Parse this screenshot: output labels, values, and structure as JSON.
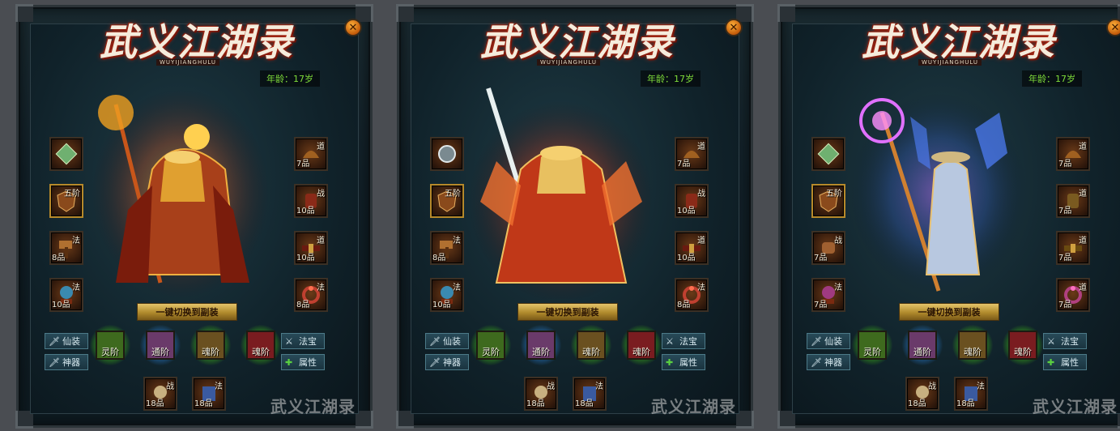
{
  "panels": [
    {
      "variant": "fire",
      "title": "武义江湖录",
      "subtitle": "WUYIJIANGHULU",
      "age": "年龄：17岁",
      "left_slots": [
        {
          "tag": "",
          "grade": "",
          "icon": "jade-crystal-icon"
        },
        {
          "tag": "五阶",
          "grade": "",
          "icon": "shield-icon"
        },
        {
          "tag": "法",
          "grade": "8品",
          "icon": "hammer-icon"
        },
        {
          "tag": "法",
          "grade": "10品",
          "icon": "orb-boots-icon"
        }
      ],
      "right_slots": [
        {
          "tag": "道",
          "grade": "7品",
          "icon": "helmet-icon"
        },
        {
          "tag": "战",
          "grade": "10品",
          "icon": "gauntlet-icon"
        },
        {
          "tag": "道",
          "grade": "10品",
          "icon": "belt-icon"
        },
        {
          "tag": "法",
          "grade": "8品",
          "icon": "ring-icon"
        }
      ]
    },
    {
      "variant": "warrior",
      "title": "武义江湖录",
      "subtitle": "WUYIJIANGHULU",
      "age": "年龄：17岁",
      "left_slots": [
        {
          "tag": "",
          "grade": "",
          "icon": "medallion-icon"
        },
        {
          "tag": "五阶",
          "grade": "",
          "icon": "shield-icon"
        },
        {
          "tag": "法",
          "grade": "8品",
          "icon": "hammer-icon"
        },
        {
          "tag": "法",
          "grade": "10品",
          "icon": "orb-boots-icon"
        }
      ],
      "right_slots": [
        {
          "tag": "道",
          "grade": "7品",
          "icon": "helmet-icon"
        },
        {
          "tag": "战",
          "grade": "10品",
          "icon": "gauntlet-icon"
        },
        {
          "tag": "道",
          "grade": "10品",
          "icon": "belt-icon"
        },
        {
          "tag": "法",
          "grade": "8品",
          "icon": "ring-icon"
        }
      ]
    },
    {
      "variant": "mage",
      "title": "武义江湖录",
      "subtitle": "WUYIJIANGHULU",
      "age": "年龄：17岁",
      "left_slots": [
        {
          "tag": "",
          "grade": "",
          "icon": "jade-crystal-icon"
        },
        {
          "tag": "五阶",
          "grade": "",
          "icon": "shield-icon"
        },
        {
          "tag": "战",
          "grade": "7品",
          "icon": "bracer-icon"
        },
        {
          "tag": "法",
          "grade": "7品",
          "icon": "orb-boots-icon"
        }
      ],
      "right_slots": [
        {
          "tag": "道",
          "grade": "7品",
          "icon": "helmet-icon"
        },
        {
          "tag": "道",
          "grade": "7品",
          "icon": "gauntlet-icon"
        },
        {
          "tag": "道",
          "grade": "7品",
          "icon": "belt-icon"
        },
        {
          "tag": "道",
          "grade": "7品",
          "icon": "ring-icon"
        }
      ]
    }
  ],
  "common": {
    "switch_label": "一键切换到副装",
    "xianzhuang": "仙装",
    "shenqi": "神器",
    "fabao": "法宝",
    "shuxing": "属性",
    "ranks": [
      "灵阶",
      "通阶",
      "魂阶",
      "魂阶"
    ],
    "bottom_slots": [
      {
        "tag": "战",
        "grade": "18品"
      },
      {
        "tag": "法",
        "grade": "18品"
      }
    ],
    "watermark": "武义江湖录",
    "close": "✕"
  },
  "colors": {
    "age_text": "#7fdc3a",
    "rank_green": "#78ff3c",
    "rank_blue": "#50c8ff",
    "switch_gold": "#e4c46a"
  }
}
